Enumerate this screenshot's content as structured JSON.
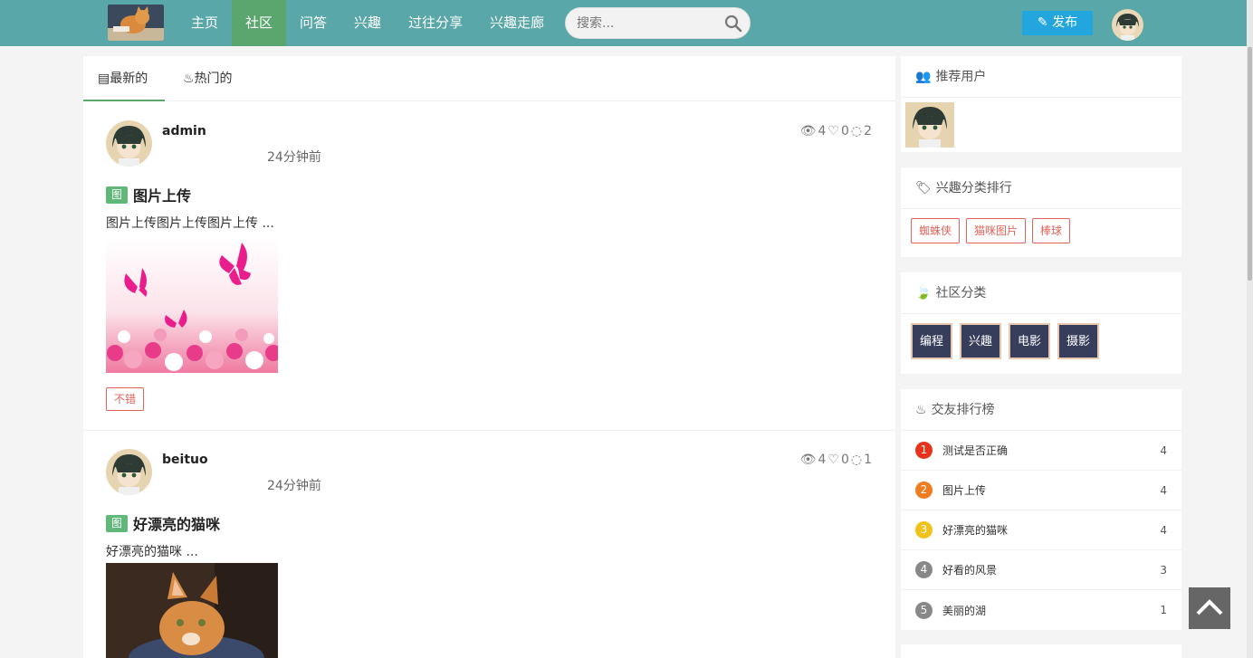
{
  "nav": {
    "items": [
      "主页",
      "社区",
      "问答",
      "兴趣",
      "过往分享",
      "兴趣走廊"
    ],
    "active_index": 1,
    "search_placeholder": "搜索...",
    "publish_label": "发布"
  },
  "feed": {
    "tabs": [
      "最新的",
      "热门的"
    ],
    "posts": [
      {
        "user": "admin",
        "time": "24分钟前",
        "views": "4",
        "likes": "0",
        "comments": "2",
        "badge": "图",
        "title": "图片上传",
        "excerpt": "图片上传图片上传图片上传 ...",
        "image": "butterflies-and-roses",
        "tag": "不错"
      },
      {
        "user": "beituo",
        "time": "24分钟前",
        "views": "4",
        "likes": "0",
        "comments": "1",
        "badge": "图",
        "title": "好漂亮的猫咪",
        "excerpt": "好漂亮的猫咪 ...",
        "image": "kitten"
      }
    ]
  },
  "sidebar": {
    "recommended_title": "推荐用户",
    "interest_title": "兴趣分类排行",
    "interest_tags": [
      "蜘蛛侠",
      "猫咪图片",
      "棒球"
    ],
    "category_title": "社区分类",
    "categories": [
      "编程",
      "兴趣",
      "电影",
      "摄影"
    ],
    "ranking_title": "交友排行榜",
    "ranking": [
      {
        "num": "1",
        "title": "测试是否正确",
        "count": "4",
        "color": "#e7321c"
      },
      {
        "num": "2",
        "title": "图片上传",
        "count": "4",
        "color": "#f07c22"
      },
      {
        "num": "3",
        "title": "好漂亮的猫咪",
        "count": "4",
        "color": "#f2c21b"
      },
      {
        "num": "4",
        "title": "好看的风景",
        "count": "3",
        "color": "#888888"
      },
      {
        "num": "5",
        "title": "美丽的湖",
        "count": "1",
        "color": "#888888"
      }
    ]
  },
  "colors": {
    "topbar": "#5aa7a9",
    "active_nav": "#5ba66f",
    "publish": "#22a6dd",
    "tag_red": "#e0645a",
    "category_bg": "#373e5c"
  }
}
